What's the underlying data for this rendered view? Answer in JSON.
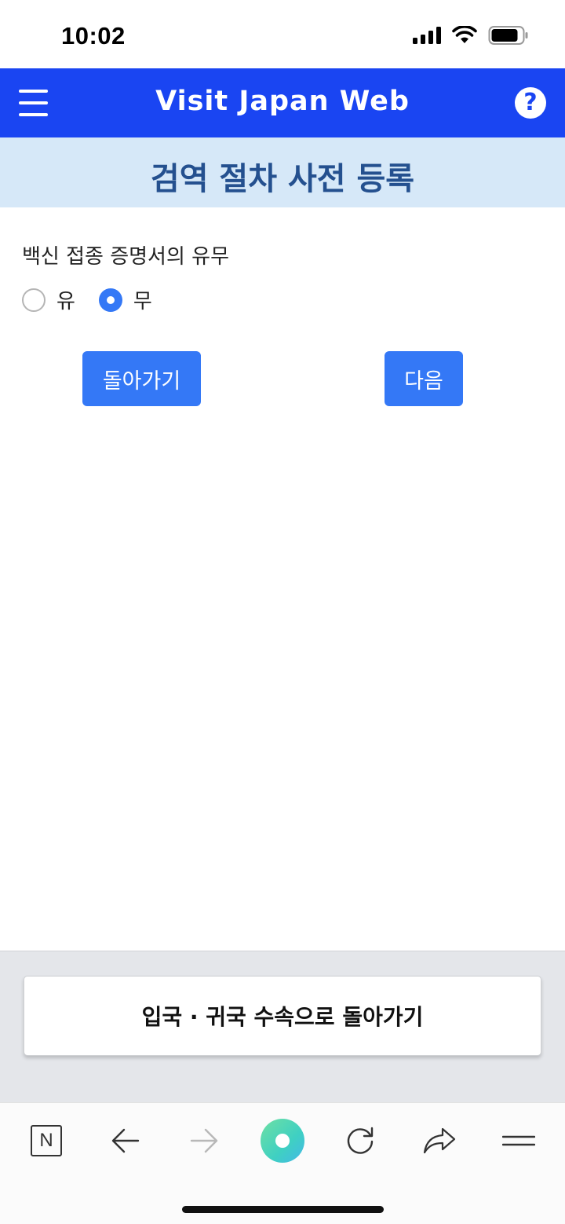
{
  "status_bar": {
    "time": "10:02"
  },
  "header": {
    "title": "Visit Japan Web",
    "menu_icon": "hamburger-menu-icon",
    "help_icon_glyph": "?",
    "brand_color": "#1a45f2"
  },
  "page": {
    "title": "검역 절차 사전 등록"
  },
  "form": {
    "question": "백신 접종 증명서의 유무",
    "options": [
      {
        "label": "유",
        "checked": false
      },
      {
        "label": "무",
        "checked": true
      }
    ],
    "back_label": "돌아가기",
    "next_label": "다음",
    "accent_color": "#3478f6"
  },
  "footer": {
    "return_label": "입국 · 귀국 수속으로 돌아가기"
  },
  "browser_toolbar": {
    "naver_label": "N",
    "icons": [
      "naver-icon",
      "back-arrow-icon",
      "forward-arrow-icon",
      "home-icon",
      "reload-icon",
      "share-icon",
      "menu-icon"
    ]
  }
}
